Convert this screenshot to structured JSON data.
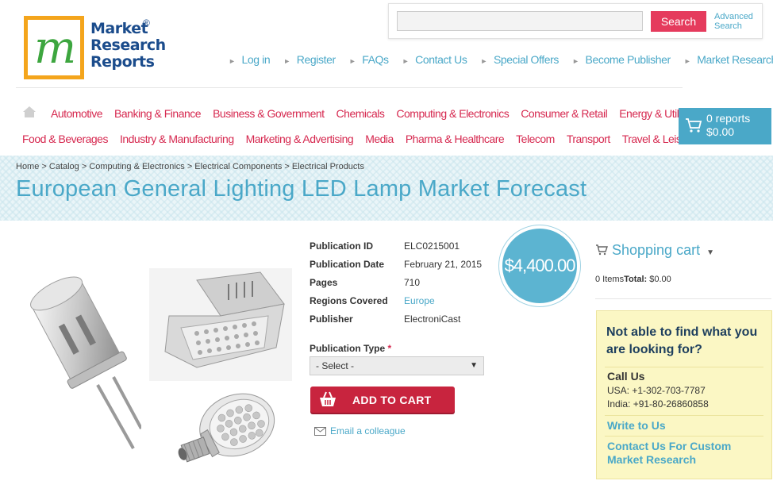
{
  "logo": {
    "mark": "m",
    "line1": "Market",
    "line2": "Research",
    "line3": "Reports",
    "reg": "®"
  },
  "search": {
    "button": "Search",
    "advanced_line1": "Advanced",
    "advanced_line2": "Search"
  },
  "top_nav": [
    "Log in",
    "Register",
    "FAQs",
    "Contact Us",
    "Special Offers",
    "Become Publisher",
    "Market Research Blog"
  ],
  "categories_row1": [
    "Automotive",
    "Banking & Finance",
    "Business & Government",
    "Chemicals",
    "Computing & Electronics",
    "Consumer & Retail",
    "Energy & Utilities"
  ],
  "categories_row2": [
    "Food & Beverages",
    "Industry & Manufacturing",
    "Marketing & Advertising",
    "Media",
    "Pharma & Healthcare",
    "Telecom",
    "Transport",
    "Travel & Leisure"
  ],
  "cart_button": {
    "reports": "0 reports",
    "amount": "$0.00"
  },
  "breadcrumb": "Home > Catalog > Computing & Electronics > Electrical Components > Electrical Products",
  "title": "European General Lighting LED Lamp Market Forecast",
  "details": [
    {
      "key": "Publication ID",
      "value": "ELC0215001"
    },
    {
      "key": "Publication Date",
      "value": "February 21, 2015"
    },
    {
      "key": "Pages",
      "value": "710"
    },
    {
      "key": "Regions Covered",
      "value": "Europe"
    },
    {
      "key": "Publisher",
      "value": "ElectroniCast"
    }
  ],
  "price": "$4,400.00",
  "publication_type": {
    "label": "Publication Type",
    "required_mark": "*",
    "selected": "- Select -"
  },
  "add_to_cart": "ADD TO CART",
  "email_colleague": "Email a colleague",
  "shopping_cart": {
    "title": "Shopping cart",
    "items": "0 Items",
    "total_label": "Total:",
    "total_value": "$0.00"
  },
  "help": {
    "question": "Not able to find what you are looking for?",
    "call_us": "Call Us",
    "phone_usa": "USA: +1-302-703-7787",
    "phone_india": "India: +91-80-26860858",
    "write": "Write to Us",
    "custom": "Contact Us For Custom Market Research"
  },
  "colors": {
    "accent_blue": "#4aa8c8",
    "category_red": "#d6284f",
    "search_red": "#e53b5d",
    "cart_red": "#c8243e",
    "logo_orange": "#f4a51c",
    "help_bg": "#fbf7c4"
  }
}
